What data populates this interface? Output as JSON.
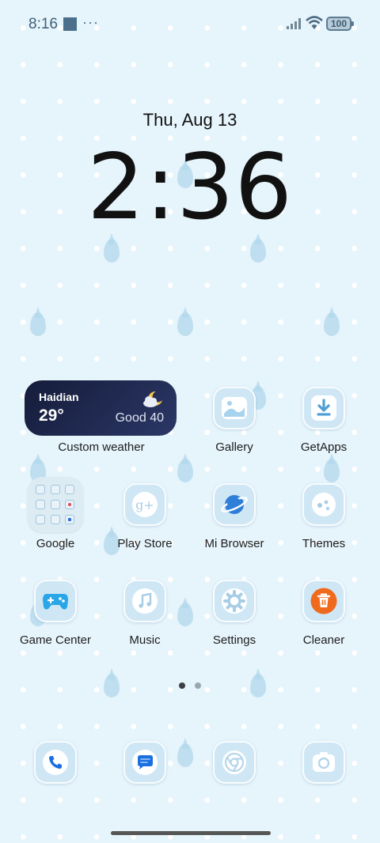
{
  "status_bar": {
    "time": "8:16",
    "battery": "100"
  },
  "lock": {
    "date": "Thu, Aug 13",
    "time": "2:36"
  },
  "weather_widget": {
    "city": "Haidian",
    "temperature": "29°",
    "air_quality": "Good 40",
    "label": "Custom weather"
  },
  "apps": {
    "gallery": "Gallery",
    "getapps": "GetApps",
    "google": "Google",
    "play_store": "Play Store",
    "mi_browser": "Mi Browser",
    "themes": "Themes",
    "game_center": "Game Center",
    "music": "Music",
    "settings": "Settings",
    "cleaner": "Cleaner"
  },
  "pager": {
    "pages": 2,
    "active": 1
  },
  "colors": {
    "icon_blue": "#4f9fd6",
    "cleaner_orange": "#f06a1e",
    "widget_bg": "#1c2547"
  },
  "icons": [
    "gallery-icon",
    "download-icon",
    "google-plus-icon",
    "planet-icon",
    "themes-icon",
    "gamepad-icon",
    "music-note-icon",
    "gear-icon",
    "trash-icon",
    "phone-icon",
    "messages-icon",
    "chrome-icon",
    "camera-icon"
  ]
}
